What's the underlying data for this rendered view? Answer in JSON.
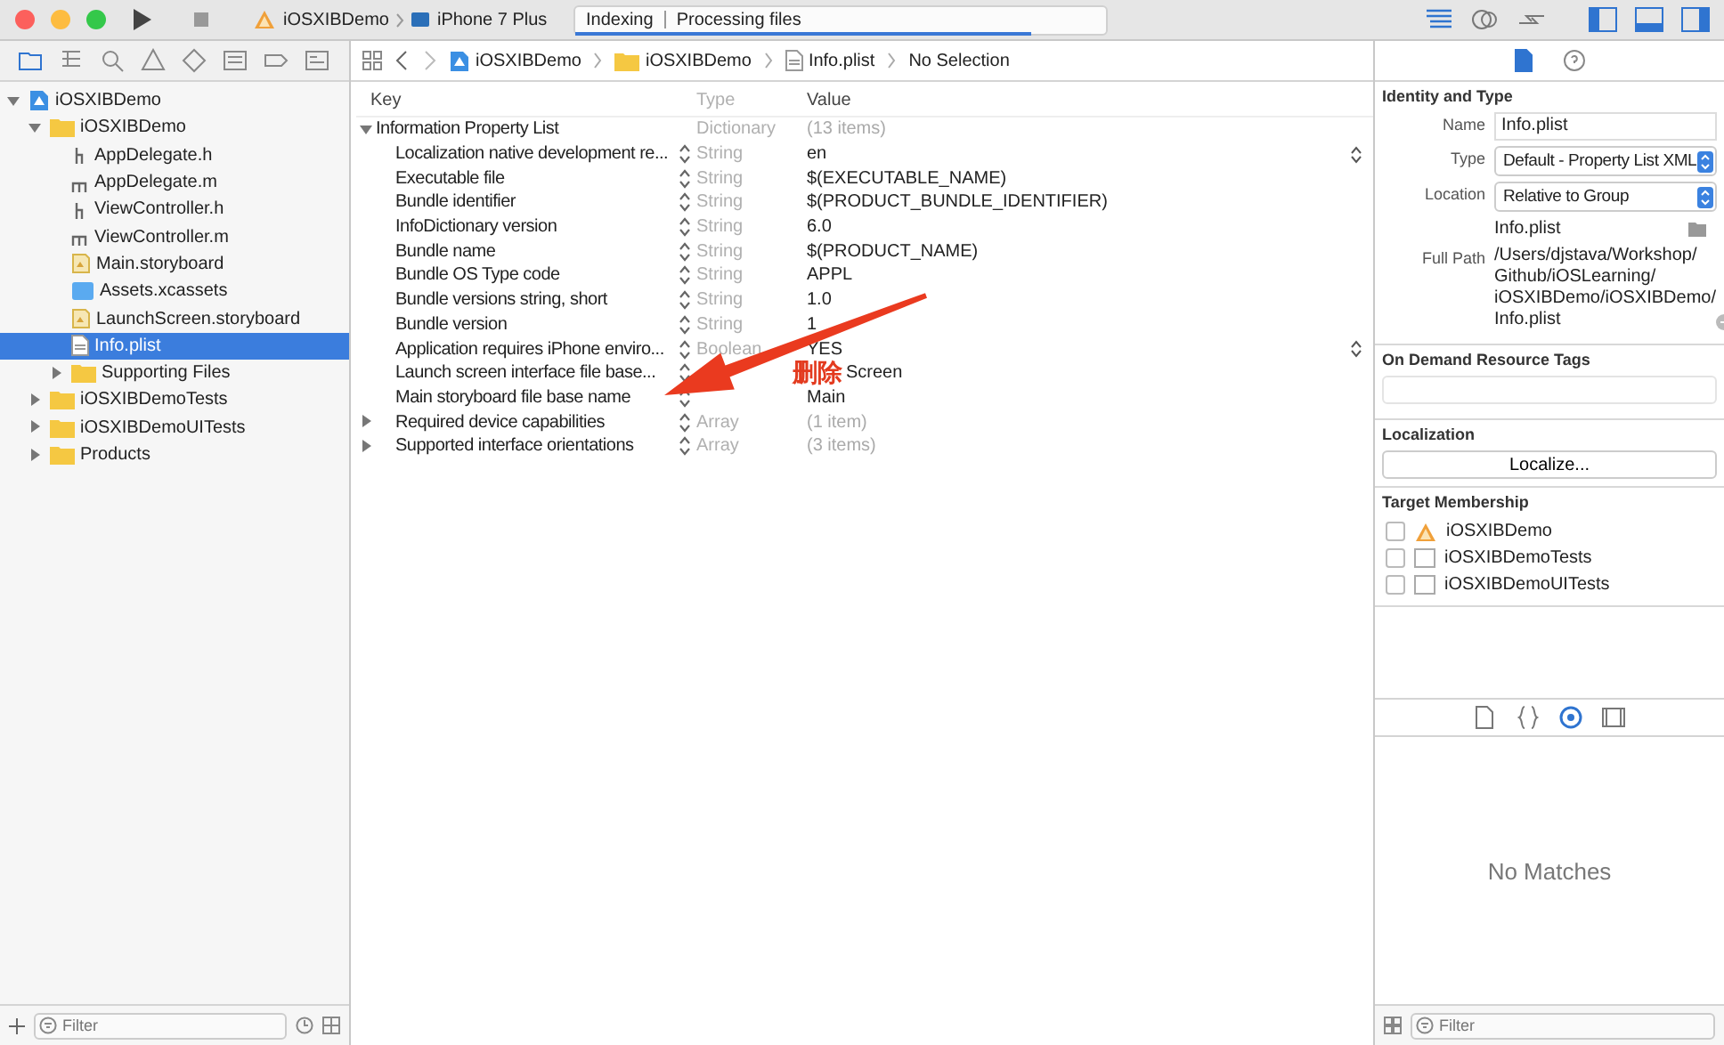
{
  "toolbar": {
    "scheme": "iOSXIBDemo",
    "device": "iPhone 7 Plus",
    "activity": {
      "status": "Indexing",
      "detail": "Processing files",
      "level": 0.86
    }
  },
  "navigator": {
    "tabs": [
      {
        "selected": true
      },
      {
        "selected": false
      },
      {
        "selected": false
      },
      {
        "selected": false
      },
      {
        "selected": false
      },
      {
        "selected": false
      },
      {
        "selected": false
      },
      {
        "selected": false
      }
    ],
    "tree": [
      {
        "label": "iOSXIBDemo",
        "kind": "project",
        "expanded": true,
        "selected": false,
        "children": [
          {
            "label": "iOSXIBDemo",
            "kind": "folder",
            "expanded": true,
            "selected": false,
            "children": [
              {
                "label": "AppDelegate.h",
                "kind": "header",
                "selected": false
              },
              {
                "label": "AppDelegate.m",
                "kind": "source",
                "selected": false
              },
              {
                "label": "ViewController.h",
                "kind": "header",
                "selected": false
              },
              {
                "label": "ViewController.m",
                "kind": "source",
                "selected": false
              },
              {
                "label": "Main.storyboard",
                "kind": "storyboard",
                "selected": false
              },
              {
                "label": "Assets.xcassets",
                "kind": "assets",
                "selected": false
              },
              {
                "label": "LaunchScreen.storyboard",
                "kind": "storyboard",
                "selected": false
              },
              {
                "label": "Info.plist",
                "kind": "plist",
                "selected": true
              },
              {
                "label": "Supporting Files",
                "kind": "folder",
                "expanded": false,
                "selected": false
              }
            ]
          },
          {
            "label": "iOSXIBDemoTests",
            "kind": "folder",
            "expanded": false,
            "selected": false
          },
          {
            "label": "iOSXIBDemoUITests",
            "kind": "folder",
            "expanded": false,
            "selected": false
          },
          {
            "label": "Products",
            "kind": "folder",
            "expanded": false,
            "selected": false
          }
        ]
      }
    ],
    "filter": {
      "placeholder": "Filter"
    }
  },
  "jump_bar": {
    "path": [
      {
        "kind": "project",
        "label": "iOSXIBDemo"
      },
      {
        "kind": "folder",
        "label": "iOSXIBDemo"
      },
      {
        "kind": "plist",
        "label": "Info.plist"
      },
      {
        "kind": "text",
        "label": "No Selection"
      }
    ]
  },
  "plist": {
    "columns": [
      "Key",
      "Type",
      "Value"
    ],
    "root": {
      "key": "Information Property List",
      "type": "Dictionary",
      "value": "(13 items)",
      "expanded": true
    },
    "rows": [
      {
        "key": "Localization native development re...",
        "type": "String",
        "value": "en",
        "popup": true
      },
      {
        "key": "Executable file",
        "type": "String",
        "value": "$(EXECUTABLE_NAME)"
      },
      {
        "key": "Bundle identifier",
        "type": "String",
        "value": "$(PRODUCT_BUNDLE_IDENTIFIER)"
      },
      {
        "key": "InfoDictionary version",
        "type": "String",
        "value": "6.0"
      },
      {
        "key": "Bundle name",
        "type": "String",
        "value": "$(PRODUCT_NAME)"
      },
      {
        "key": "Bundle OS Type code",
        "type": "String",
        "value": "APPL"
      },
      {
        "key": "Bundle versions string, short",
        "type": "String",
        "value": "1.0"
      },
      {
        "key": "Bundle version",
        "type": "String",
        "value": "1"
      },
      {
        "key": "Application requires iPhone enviro...",
        "type": "Boolean",
        "value": "YES",
        "popup": true
      },
      {
        "key": "Launch screen interface file base...",
        "value": "Screen",
        "note": "删除"
      },
      {
        "key": "Main storyboard file base name",
        "value": "Main"
      },
      {
        "key": "Required device capabilities",
        "type": "Array",
        "value": "(1 item)",
        "expanded": false
      },
      {
        "key": "Supported interface orientations",
        "type": "Array",
        "value": "(3 items)",
        "expanded": false
      }
    ]
  },
  "inspector": {
    "tabs": [
      {
        "selected": true
      },
      {
        "selected": false
      }
    ],
    "identity": {
      "title": "Identity and Type",
      "name_label": "Name",
      "name": "Info.plist",
      "type_label": "Type",
      "type": "Default - Property List XML",
      "location_label": "Location",
      "location": "Relative to Group",
      "file": "Info.plist",
      "path_label": "Full Path",
      "path_lines": [
        "/Users/djstava/Workshop/",
        "Github/iOSLearning/",
        "iOSXIBDemo/iOSXIBDemo/",
        "Info.plist"
      ]
    },
    "odr": {
      "title": "On Demand Resource Tags"
    },
    "localization": {
      "title": "Localization",
      "button": "Localize..."
    },
    "membership": {
      "title": "Target Membership",
      "targets": [
        {
          "label": "iOSXIBDemo",
          "kind": "app",
          "checked": false
        },
        {
          "label": "iOSXIBDemoTests",
          "kind": "bundle",
          "checked": false
        },
        {
          "label": "iOSXIBDemoUITests",
          "kind": "bundle",
          "checked": false
        }
      ]
    },
    "library": {
      "tabs": [
        {
          "selected": false
        },
        {
          "selected": false
        },
        {
          "selected": true
        },
        {
          "selected": false
        }
      ],
      "empty": "No Matches",
      "filter": {
        "placeholder": "Filter"
      }
    }
  }
}
